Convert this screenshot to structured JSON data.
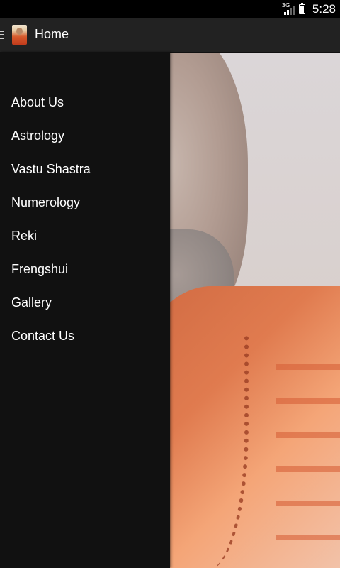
{
  "status_bar": {
    "network": "3G",
    "time": "5:28"
  },
  "action_bar": {
    "title": "Home",
    "icons": {
      "drawer_toggle": "hamburger-icon",
      "app_icon": "app-logo-icon"
    }
  },
  "drawer": {
    "items": [
      {
        "label": "About Us"
      },
      {
        "label": "Astrology"
      },
      {
        "label": "Vastu Shastra"
      },
      {
        "label": "Numerology"
      },
      {
        "label": "Reki"
      },
      {
        "label": "Frengshui"
      },
      {
        "label": "Gallery"
      },
      {
        "label": "Contact Us"
      }
    ]
  },
  "colors": {
    "status_bar_bg": "#000000",
    "action_bar_bg": "#222222",
    "drawer_bg": "#111111",
    "text": "#ffffff"
  }
}
